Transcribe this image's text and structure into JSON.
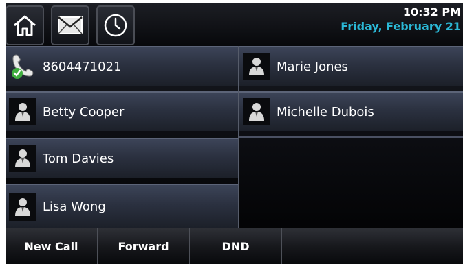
{
  "status": {
    "time": "10:32 PM",
    "date": "Friday, February 21"
  },
  "toolbar": {
    "icons": [
      "home-icon",
      "mail-icon",
      "clock-icon"
    ]
  },
  "line_keys": {
    "left": [
      {
        "label": "8604471021",
        "icon": "phone-line-registered-icon"
      },
      {
        "label": "Betty Cooper",
        "icon": "contact-icon"
      },
      {
        "label": "Tom Davies",
        "icon": "contact-icon"
      },
      {
        "label": "Lisa Wong",
        "icon": "contact-icon"
      }
    ],
    "right": [
      {
        "label": "Marie Jones",
        "icon": "contact-icon"
      },
      {
        "label": "Michelle Dubois",
        "icon": "contact-icon"
      }
    ]
  },
  "softkeys": [
    "New Call",
    "Forward",
    "DND"
  ],
  "colors": {
    "date_accent": "#2bb8d6",
    "registered_check": "#3fae3f"
  }
}
